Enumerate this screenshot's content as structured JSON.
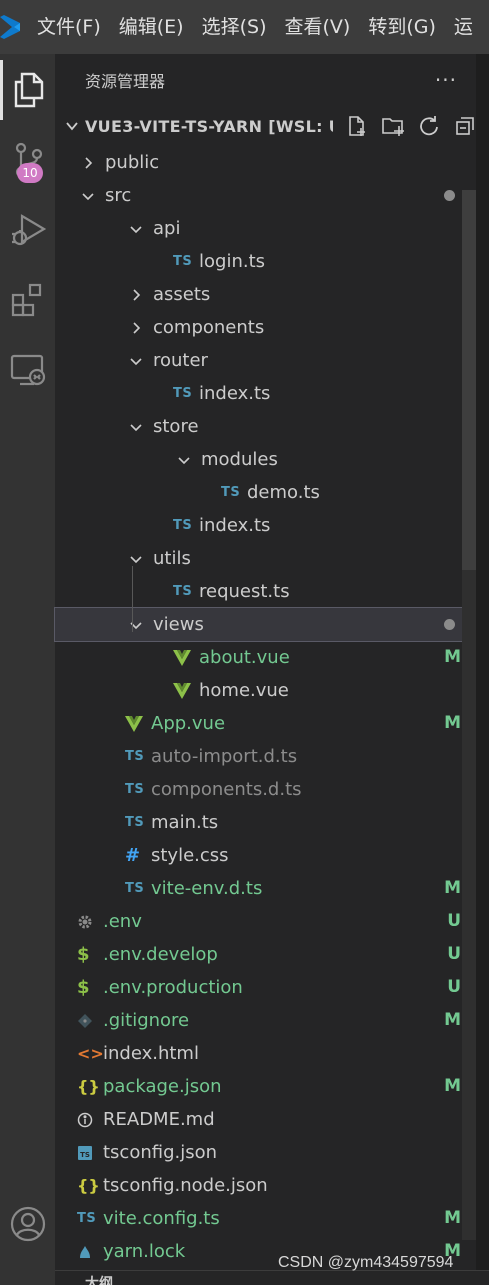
{
  "menubar": {
    "items": [
      "文件(F)",
      "编辑(E)",
      "选择(S)",
      "查看(V)",
      "转到(G)",
      "运"
    ]
  },
  "activity": {
    "scm_badge": "10"
  },
  "sidebar": {
    "title": "资源管理器",
    "more": "···",
    "folder_title": "VUE3-VITE-TS-YARN [WSL: U..."
  },
  "tree": [
    {
      "label": "public",
      "depth": 0,
      "kind": "folder",
      "expanded": false
    },
    {
      "label": "src",
      "depth": 0,
      "kind": "folder",
      "expanded": true,
      "dot": true
    },
    {
      "label": "api",
      "depth": 1,
      "kind": "folder",
      "expanded": true
    },
    {
      "label": "login.ts",
      "depth": 2,
      "kind": "ts",
      "icon_text": "TS"
    },
    {
      "label": "assets",
      "depth": 1,
      "kind": "folder",
      "expanded": false
    },
    {
      "label": "components",
      "depth": 1,
      "kind": "folder",
      "expanded": false
    },
    {
      "label": "router",
      "depth": 1,
      "kind": "folder",
      "expanded": true
    },
    {
      "label": "index.ts",
      "depth": 2,
      "kind": "ts",
      "icon_text": "TS"
    },
    {
      "label": "store",
      "depth": 1,
      "kind": "folder",
      "expanded": true
    },
    {
      "label": "modules",
      "depth": 2,
      "kind": "folder",
      "expanded": true
    },
    {
      "label": "demo.ts",
      "depth": 3,
      "kind": "ts",
      "icon_text": "TS"
    },
    {
      "label": "index.ts",
      "depth": 2,
      "kind": "ts",
      "icon_text": "TS"
    },
    {
      "label": "utils",
      "depth": 1,
      "kind": "folder",
      "expanded": true
    },
    {
      "label": "request.ts",
      "depth": 2,
      "kind": "ts",
      "icon_text": "TS"
    },
    {
      "label": "views",
      "depth": 1,
      "kind": "folder",
      "expanded": true,
      "dot": true,
      "selected": true
    },
    {
      "label": "about.vue",
      "depth": 2,
      "kind": "vue",
      "status": "modified",
      "deco": "M"
    },
    {
      "label": "home.vue",
      "depth": 2,
      "kind": "vue"
    },
    {
      "label": "App.vue",
      "depth": 1,
      "kind": "vue",
      "status": "modified",
      "deco": "M"
    },
    {
      "label": "auto-import.d.ts",
      "depth": 1,
      "kind": "ts",
      "icon_text": "TS",
      "status": "ignored"
    },
    {
      "label": "components.d.ts",
      "depth": 1,
      "kind": "ts",
      "icon_text": "TS",
      "status": "ignored"
    },
    {
      "label": "main.ts",
      "depth": 1,
      "kind": "ts",
      "icon_text": "TS"
    },
    {
      "label": "style.css",
      "depth": 1,
      "kind": "css",
      "icon_text": "#"
    },
    {
      "label": "vite-env.d.ts",
      "depth": 1,
      "kind": "ts",
      "icon_text": "TS",
      "status": "modified",
      "deco": "M"
    },
    {
      "label": ".env",
      "depth": 0,
      "kind": "gear",
      "status": "untracked",
      "deco": "U"
    },
    {
      "label": ".env.develop",
      "depth": 0,
      "kind": "dollar",
      "icon_text": "$",
      "status": "untracked",
      "deco": "U"
    },
    {
      "label": ".env.production",
      "depth": 0,
      "kind": "dollar",
      "icon_text": "$",
      "status": "untracked",
      "deco": "U"
    },
    {
      "label": ".gitignore",
      "depth": 0,
      "kind": "git",
      "status": "modified",
      "deco": "M"
    },
    {
      "label": "index.html",
      "depth": 0,
      "kind": "html",
      "icon_text": "<>"
    },
    {
      "label": "package.json",
      "depth": 0,
      "kind": "json",
      "icon_text": "{}",
      "status": "modified",
      "deco": "M"
    },
    {
      "label": "README.md",
      "depth": 0,
      "kind": "info",
      "icon_text": "ⓘ"
    },
    {
      "label": "tsconfig.json",
      "depth": 0,
      "kind": "tsconfig",
      "icon_text": "TS"
    },
    {
      "label": "tsconfig.node.json",
      "depth": 0,
      "kind": "json",
      "icon_text": "{}"
    },
    {
      "label": "vite.config.ts",
      "depth": 0,
      "kind": "ts",
      "icon_text": "TS",
      "status": "modified",
      "deco": "M"
    },
    {
      "label": "yarn.lock",
      "depth": 0,
      "kind": "yarn",
      "status": "modified",
      "deco": "M"
    }
  ],
  "outline": {
    "title": "大纲"
  },
  "watermark": "CSDN @zym434597594",
  "colors": {
    "modified": "#73c991",
    "ignored": "#8c8c8c",
    "ts_icon": "#519aba",
    "vue_icon": "#8dc149",
    "json_icon": "#cbcb41",
    "html_icon": "#e37933",
    "dollar_icon": "#8dc149",
    "badge": "#d07ac4"
  }
}
